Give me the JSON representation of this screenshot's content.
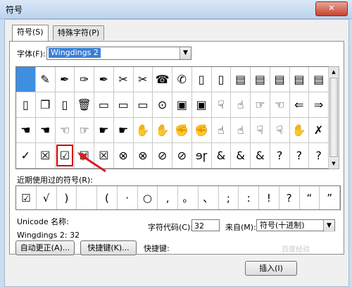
{
  "window": {
    "title": "符号",
    "close_label": "✕"
  },
  "tabs": [
    {
      "label": "符号(S)",
      "active": true
    },
    {
      "label": "特殊字符(P)",
      "active": false
    }
  ],
  "font": {
    "label": "字体(F):",
    "value": "Wingdings 2"
  },
  "symbols": [
    [
      "",
      "✎",
      "✒",
      "✑",
      "✒",
      "✂",
      "✂",
      "☎",
      "✆",
      "▯",
      "▯",
      "▤",
      "▤",
      "▤",
      "▤",
      "▤"
    ],
    [
      "▯",
      "❐",
      "▯",
      "🗑",
      "▭",
      "▭",
      "▭",
      "⊙",
      "▣",
      "▣",
      "☟",
      "☝",
      "☞",
      "☜",
      "⇐",
      "⇒"
    ],
    [
      "☚",
      "☚",
      "☜",
      "☞",
      "☛",
      "☛",
      "✋",
      "✋",
      "✊",
      "✊",
      "☝",
      "☝",
      "☟",
      "☟",
      "✋",
      "✗"
    ],
    [
      "✓",
      "☒",
      "☑",
      "☒",
      "☒",
      "⊗",
      "⊗",
      "⊘",
      "⊘",
      "ɘɼ",
      "&",
      "&",
      "&",
      "?",
      "?",
      "?"
    ]
  ],
  "recent": {
    "label": "近期使用过的符号(R):",
    "items": [
      "☑",
      "√",
      ")",
      "",
      "(",
      "·",
      "○",
      ",",
      "。",
      "、",
      ";",
      ":",
      "!",
      "?",
      "“",
      "”",
      "("
    ]
  },
  "unicode": {
    "name_label": "Unicode 名称:",
    "value": "Wingdings 2: 32"
  },
  "charcode": {
    "label": "字符代码(C):",
    "value": "32"
  },
  "from": {
    "label": "来自(M):",
    "value": "符号(十进制)"
  },
  "buttons": {
    "autocorrect": "自动更正(A)...",
    "shortcut_key": "快捷键(K)...",
    "shortcut_text": "快捷键:",
    "insert": "插入(I)"
  },
  "watermark": "百度经验"
}
